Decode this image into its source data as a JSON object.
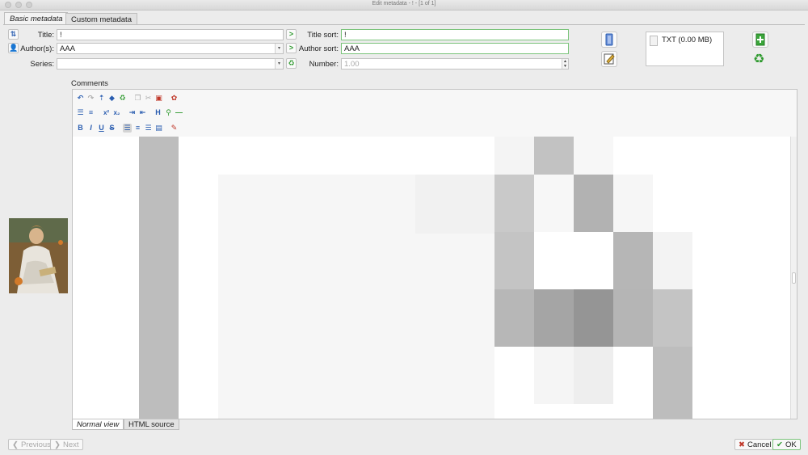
{
  "window": {
    "title": "Edit metadata - ! -  [1 of 1]"
  },
  "tabs": [
    {
      "label": "Basic metadata",
      "active": true
    },
    {
      "label": "Custom metadata",
      "active": false
    }
  ],
  "fields": {
    "title": {
      "label": "Title:",
      "value": "!"
    },
    "authors": {
      "label": "Author(s):",
      "value": "AAA"
    },
    "series": {
      "label": "Series:",
      "value": ""
    },
    "title_sort": {
      "label": "Title sort:",
      "value": "!"
    },
    "author_sort": {
      "label": "Author sort:",
      "value": "AAA"
    },
    "number": {
      "label": "Number:",
      "value": "1.00"
    }
  },
  "formats": [
    {
      "label": "TXT (0.00 MB)"
    }
  ],
  "comments": {
    "label": "Comments",
    "tabs": [
      {
        "label": "Normal view",
        "active": true
      },
      {
        "label": "HTML source",
        "active": false
      }
    ]
  },
  "toolbar": {
    "row1": [
      "undo-icon",
      "redo-icon",
      "select-all-icon",
      "clear-icon",
      "remove-format-icon",
      "copy-icon",
      "cut-icon",
      "paste-icon",
      "insert-image-icon"
    ],
    "row2": [
      "ordered-list-icon",
      "unordered-list-icon",
      "superscript-icon",
      "subscript-icon",
      "indent-icon",
      "outdent-icon",
      "heading-icon",
      "styles-icon",
      "horizontal-rule-icon"
    ],
    "row3": [
      "bold-icon",
      "italic-icon",
      "underline-icon",
      "strikethrough-icon",
      "align-left-icon",
      "align-center-icon",
      "align-right-icon",
      "justify-icon",
      "text-color-icon"
    ]
  },
  "toolbar_glyphs": {
    "sup": "x²",
    "sub": "x₂",
    "heading": "H",
    "bold": "B",
    "italic": "I",
    "underline": "U",
    "strike": "S"
  },
  "nav": {
    "previous": "Previous",
    "next": "Next"
  },
  "actions": {
    "cancel": "Cancel",
    "ok": "OK"
  },
  "colors": {
    "accent_green": "#2f9a2f",
    "field_focus_border": "#7cc47c",
    "toolbar_blue": "#2a5db0",
    "cancel_red": "#c0392b"
  }
}
